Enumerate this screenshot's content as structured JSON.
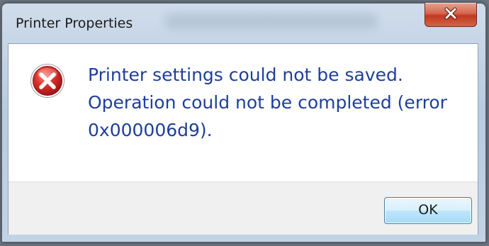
{
  "window": {
    "title": "Printer Properties"
  },
  "icons": {
    "close": "close-icon",
    "error": "error-icon"
  },
  "message": {
    "lines": [
      "Printer settings could not be saved.",
      "Operation could not be completed (error",
      "0x000006d9)."
    ]
  },
  "buttons": {
    "ok_label": "OK"
  },
  "colors": {
    "message_text": "#1e3f9b",
    "close_button": "#c1381f",
    "error_icon": "#c8202a",
    "ok_button_border": "#3c7fb1"
  }
}
